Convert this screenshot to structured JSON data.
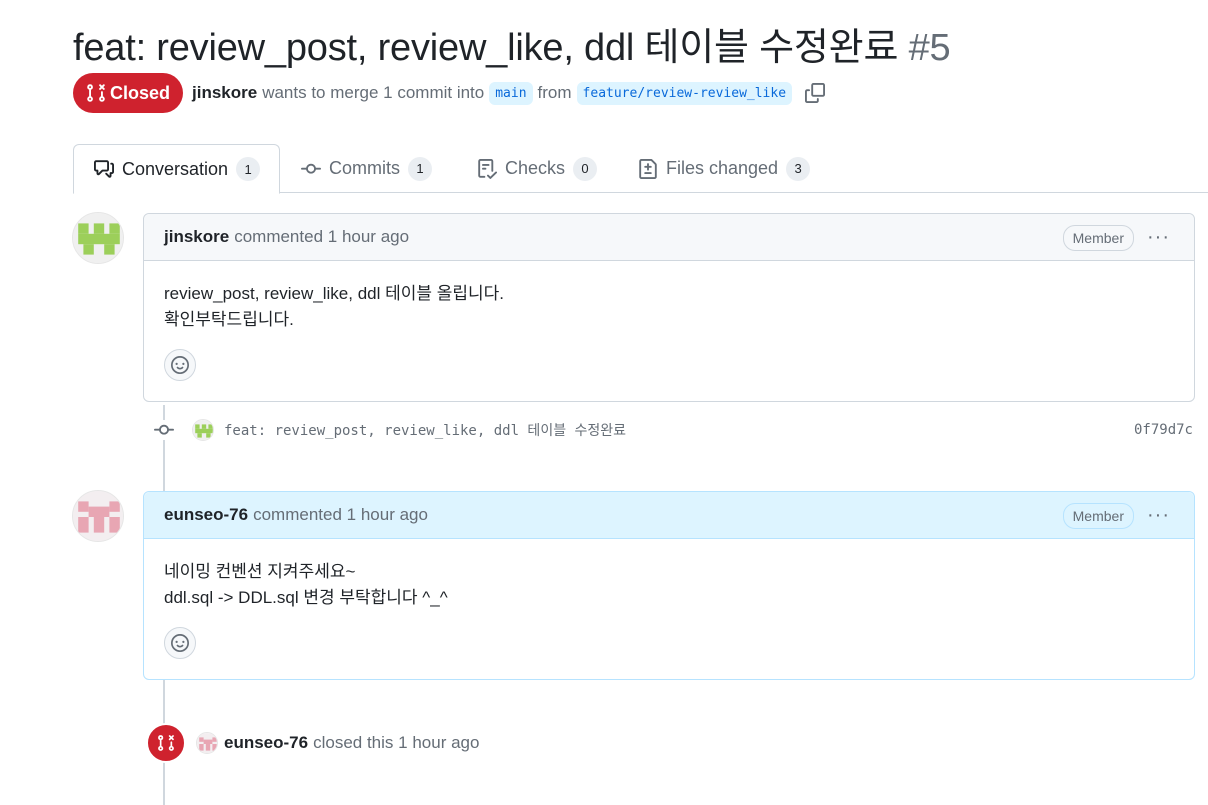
{
  "pr": {
    "title": "feat: review_post, review_like, ddl 테이블 수정완료",
    "number": "#5",
    "state": "Closed",
    "author": "jinskore",
    "merge_text": "wants to merge 1 commit into",
    "base_branch": "main",
    "from_text": "from",
    "head_branch": "feature/review-review_like"
  },
  "tabs": [
    {
      "label": "Conversation",
      "count": "1",
      "icon": "comment-discussion-icon"
    },
    {
      "label": "Commits",
      "count": "1",
      "icon": "git-commit-icon"
    },
    {
      "label": "Checks",
      "count": "0",
      "icon": "checklist-icon"
    },
    {
      "label": "Files changed",
      "count": "3",
      "icon": "file-diff-icon"
    }
  ],
  "comments": [
    {
      "author": "jinskore",
      "action": "commented",
      "time": "1 hour ago",
      "role": "Member",
      "lines": [
        "review_post, review_like, ddl 테이블 올립니다.",
        "확인부탁드립니다."
      ]
    },
    {
      "author": "eunseo-76",
      "action": "commented",
      "time": "1 hour ago",
      "role": "Member",
      "lines": [
        "네이밍 컨벤션 지켜주세요~",
        "ddl.sql -> DDL.sql 변경 부탁합니다 ^_^"
      ]
    }
  ],
  "commit": {
    "message": "feat: review_post, review_like, ddl 테이블 수정완료",
    "sha": "0f79d7c"
  },
  "event": {
    "actor": "eunseo-76",
    "text": "closed this",
    "time": "1 hour ago"
  },
  "colors": {
    "closed_red": "#cf222e",
    "link_blue": "#0969da",
    "branch_bg": "#ddf4ff",
    "avatar_green": "#9ccf5a",
    "avatar_pink": "#e8a6b3"
  }
}
